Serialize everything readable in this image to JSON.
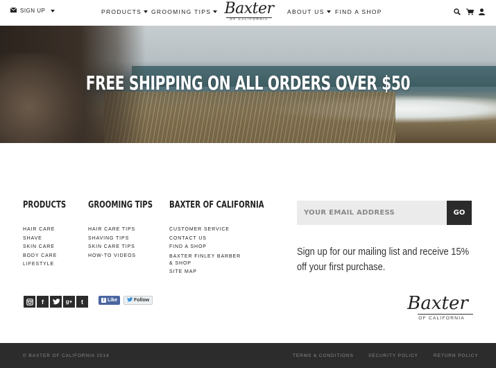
{
  "nav": {
    "signup_label": "SIGN UP",
    "links": [
      {
        "label": "PRODUCTS",
        "has_dropdown": true
      },
      {
        "label": "GROOMING TIPS",
        "has_dropdown": true
      },
      {
        "label": "ABOUT US",
        "has_dropdown": true
      },
      {
        "label": "FIND A SHOP",
        "has_dropdown": false
      }
    ],
    "logo": {
      "script": "Baxter",
      "sub": "OF CALIFORNIA"
    },
    "icons": [
      "search-icon",
      "cart-icon",
      "user-icon"
    ]
  },
  "hero": {
    "title": "FREE SHIPPING ON ALL ORDERS OVER $50"
  },
  "footer": {
    "columns": [
      {
        "heading": "PRODUCTS",
        "items": [
          "HAIR CARE",
          "SHAVE",
          "SKIN CARE",
          "BODY CARE",
          "LIFESTYLE"
        ]
      },
      {
        "heading": "GROOMING TIPS",
        "items": [
          "HAIR CARE TIPS",
          "SHAVING TIPS",
          "SKIN CARE TIPS",
          "HOW-TO VIDEOS"
        ]
      },
      {
        "heading": "BAXTER OF CALIFORNIA",
        "items": [
          "CUSTOMER SERVICE",
          "CONTACT US",
          "FIND A SHOP",
          "BAXTER FINLEY BARBER & SHOP",
          "SITE MAP"
        ]
      }
    ],
    "newsletter": {
      "placeholder": "YOUR EMAIL ADDRESS",
      "button": "GO",
      "text": "Sign up for our mailing list and receive 15% off your first purchase."
    },
    "social": {
      "icons": [
        "instagram-icon",
        "facebook-icon",
        "twitter-icon",
        "google-plus-icon",
        "tumblr-icon"
      ],
      "fb_like": "Like",
      "tw_follow": "Follow"
    },
    "logo": {
      "script": "Baxter",
      "sub": "OF CALIFORNIA"
    }
  },
  "bottom": {
    "copyright": "© BAXTER OF CALIFORNIA 2014",
    "links": [
      "TERMS & CONDITIONS",
      "SECURITY POLICY",
      "RETURN POLICY"
    ]
  }
}
